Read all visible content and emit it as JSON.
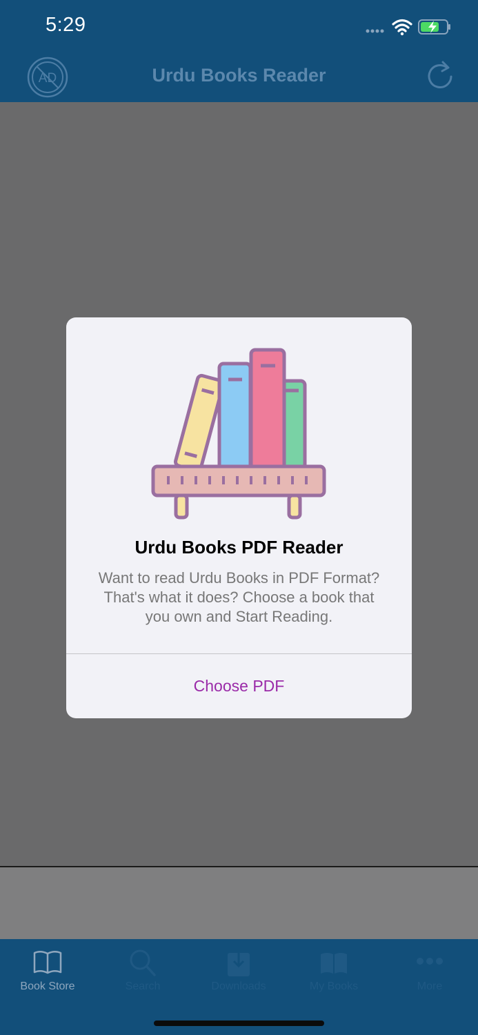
{
  "status_bar": {
    "time": "5:29",
    "icons": [
      "signal-dots-icon",
      "wifi-icon",
      "battery-charging-icon"
    ]
  },
  "nav_bar": {
    "title": "Urdu Books Reader",
    "left_icon": "no-ads-icon",
    "right_icon": "refresh-icon"
  },
  "dialog": {
    "image": "bookshelf-icon",
    "title": "Urdu Books PDF Reader",
    "message": "Want to read Urdu Books in PDF Format? That's what it does? Choose a book that you own and Start Reading.",
    "button_label": "Choose PDF"
  },
  "tab_bar": {
    "tabs": [
      {
        "label": "Book Store",
        "icon": "book-open-icon",
        "active": true
      },
      {
        "label": "Search",
        "icon": "search-icon",
        "active": false
      },
      {
        "label": "Downloads",
        "icon": "download-icon",
        "active": false
      },
      {
        "label": "My Books",
        "icon": "books-icon",
        "active": false
      },
      {
        "label": "More",
        "icon": "more-dots-icon",
        "active": false
      }
    ]
  },
  "colors": {
    "nav_background": "#124f7a",
    "overlay": "#6a6a6b",
    "dialog_button": "#9a2aa8"
  }
}
